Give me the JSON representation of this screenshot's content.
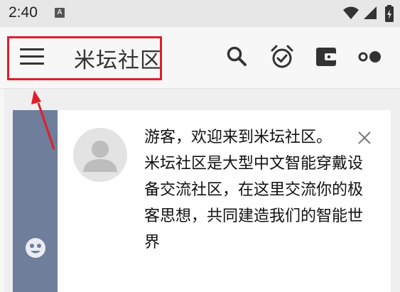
{
  "status_bar": {
    "time": "2:40",
    "notification_letter": "A",
    "icons": [
      "wifi-icon",
      "signal-icon",
      "battery-icon"
    ]
  },
  "app_bar": {
    "title": "米坛社区",
    "actions": [
      "search-icon",
      "alarm-check-icon",
      "wallet-icon",
      "more-dots-icon"
    ]
  },
  "welcome_card": {
    "greeting": "游客，欢迎来到米坛社区。",
    "description": "米坛社区是大型中文智能穿戴设备交流社区，在这里交流你的极客思想，共同建造我们的智能世界"
  },
  "colors": {
    "highlight": "#e01e2b",
    "side_strip": "#6e7e9b",
    "toolbar_icon": "#333333"
  }
}
